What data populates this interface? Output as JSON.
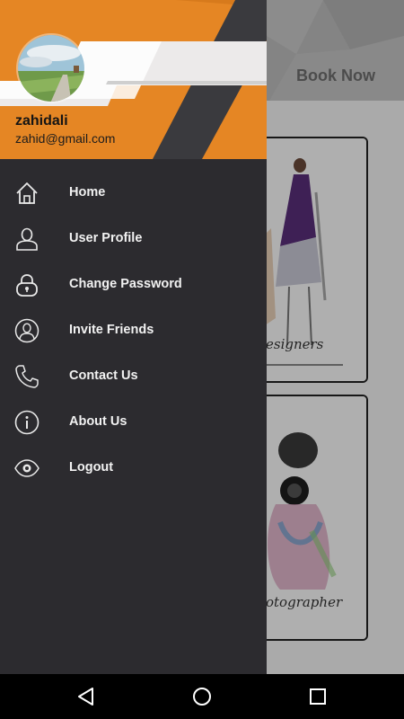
{
  "background_app": {
    "book_now_label": "Book Now",
    "cards": [
      {
        "caption": "esigners"
      },
      {
        "caption": "otographer"
      }
    ]
  },
  "drawer": {
    "user": {
      "name": "zahidali",
      "email": "zahid@gmail.com"
    },
    "colors": {
      "header_orange": "#e58624",
      "header_dark_band": "#3a3a3e",
      "drawer_background": "#2c2b2f",
      "menu_text": "#f2f2f2"
    },
    "menu": [
      {
        "label": "Home",
        "icon": "home-icon"
      },
      {
        "label": "User Profile",
        "icon": "user-icon"
      },
      {
        "label": "Change Password",
        "icon": "lock-icon"
      },
      {
        "label": "Invite Friends",
        "icon": "invite-friends-icon"
      },
      {
        "label": "Contact Us",
        "icon": "phone-icon"
      },
      {
        "label": "About Us",
        "icon": "info-icon"
      },
      {
        "label": "Logout",
        "icon": "eye-icon"
      }
    ]
  },
  "system_nav": {
    "buttons": [
      "back-icon",
      "home-circle-icon",
      "recents-icon"
    ]
  }
}
